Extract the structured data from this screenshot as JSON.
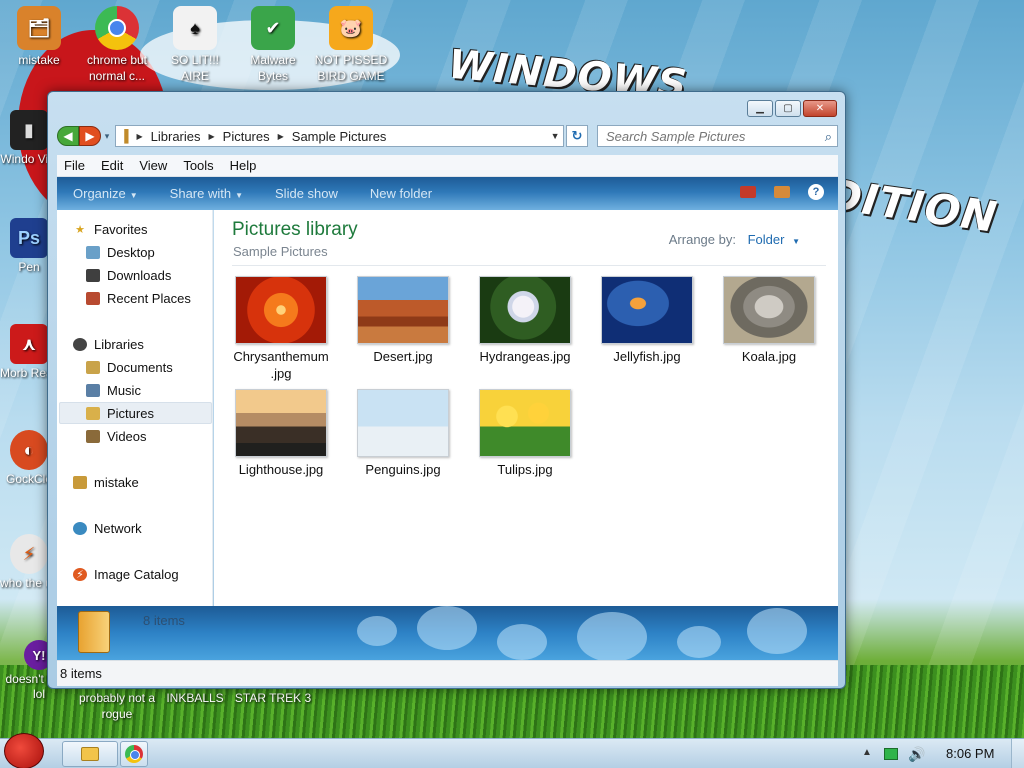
{
  "desktop": {
    "top_icons": [
      {
        "label": "mistake",
        "color": "#d9822b",
        "glyph": "🗂"
      },
      {
        "label": "chrome but normal c...",
        "color": "#4885ed",
        "glyph": ""
      },
      {
        "label": "SO LIT!!! AIRE",
        "color": "#f2f2f2",
        "glyph": "♠"
      },
      {
        "label": "Malware Bytes",
        "color": "#3aa54a",
        "glyph": "✔"
      },
      {
        "label": "NOT PISSED BIRD GAME",
        "color": "#f6a81c",
        "glyph": "🐷"
      }
    ],
    "side_icons": [
      {
        "label": "Windo Vist",
        "color": "#222222",
        "glyph": "▮"
      },
      {
        "label": "Pen",
        "color": "#1f3f8f",
        "glyph": "Ps"
      },
      {
        "label": "Morb Read",
        "color": "#cc1a1a",
        "glyph": "⋏"
      },
      {
        "label": "GockCle",
        "color": "#d84a20",
        "glyph": "◐"
      },
      {
        "label": "who the uses t",
        "color": "#e8e8e8",
        "glyph": "⚡"
      },
      {
        "label": "doesn't work lol",
        "color": "#6a1ea0",
        "glyph": "Y!"
      }
    ],
    "bottom_labels": [
      {
        "label": "probably not a rogue"
      },
      {
        "label": "INKBALLS"
      },
      {
        "label": "STAR TREK 3"
      }
    ],
    "wallpaper_text": {
      "line1": "WINDOWS",
      "line2": "S EDITION"
    }
  },
  "window": {
    "address": {
      "crumbs": [
        "Libraries",
        "Pictures",
        "Sample Pictures"
      ]
    },
    "search": {
      "placeholder": "Search Sample Pictures"
    },
    "menu": [
      "File",
      "Edit",
      "View",
      "Tools",
      "Help"
    ],
    "commands": {
      "organize": "Organize",
      "share_with": "Share with",
      "slide_show": "Slide show",
      "new_folder": "New folder"
    },
    "nav": {
      "favorites": "Favorites",
      "desktop": "Desktop",
      "downloads": "Downloads",
      "recent_places": "Recent Places",
      "libraries": "Libraries",
      "documents": "Documents",
      "music": "Music",
      "pictures": "Pictures",
      "videos": "Videos",
      "mistake": "mistake",
      "network": "Network",
      "image_catalog": "Image Catalog"
    },
    "content": {
      "title": "Pictures library",
      "subtitle": "Sample Pictures",
      "arrange_label": "Arrange by:",
      "arrange_value": "Folder",
      "files": [
        {
          "name": "Chrysanthemum .jpg",
          "line1": "Chrysanthemum",
          "line2": ".jpg"
        },
        {
          "name": "Desert.jpg",
          "line1": "Desert.jpg",
          "line2": ""
        },
        {
          "name": "Hydrangeas.jpg",
          "line1": "Hydrangeas.jpg",
          "line2": ""
        },
        {
          "name": "Jellyfish.jpg",
          "line1": "Jellyfish.jpg",
          "line2": ""
        },
        {
          "name": "Koala.jpg",
          "line1": "Koala.jpg",
          "line2": ""
        },
        {
          "name": "Lighthouse.jpg",
          "line1": "Lighthouse.jpg",
          "line2": ""
        },
        {
          "name": "Penguins.jpg",
          "line1": "Penguins.jpg",
          "line2": ""
        },
        {
          "name": "Tulips.jpg",
          "line1": "Tulips.jpg",
          "line2": ""
        }
      ]
    },
    "details_pane": {
      "count": "8 items"
    },
    "status": {
      "count": "8 items"
    }
  },
  "taskbar": {
    "clock": "8:06 PM"
  },
  "colors": {
    "library_title": "#1e7a3c",
    "command_bar": "#2e78b8",
    "link_blue": "#1f6bb0"
  }
}
